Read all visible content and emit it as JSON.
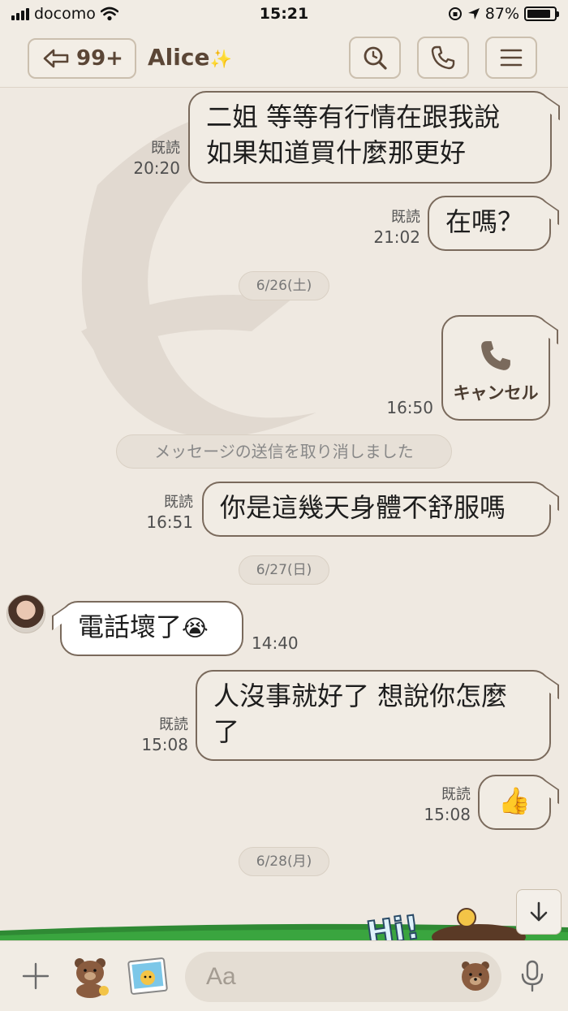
{
  "status_bar": {
    "carrier": "docomo",
    "time": "15:21",
    "battery_text": "87%",
    "battery_level": 0.87
  },
  "header": {
    "unread_count": "99+",
    "contact_name": "Alice",
    "contact_emoji": "✨",
    "icons": [
      "back-arrow-icon",
      "search-icon",
      "phone-icon",
      "menu-icon"
    ]
  },
  "messages": {
    "m1": {
      "line1": "二姐 等等有行情在跟我說",
      "line2": "如果知道買什麼那更好",
      "read": "既読",
      "time": "20:20"
    },
    "m2": {
      "text": "在嗎？",
      "read": "既読",
      "time": "21:02"
    },
    "date1": "6/26(土)",
    "m3": {
      "label": "キャンセル",
      "time": "16:50"
    },
    "system": "メッセージの送信を取り消しました",
    "m4": {
      "text": "你是這幾天身體不舒服嗎",
      "read": "既読",
      "time": "16:51"
    },
    "date2": "6/27(日)",
    "m5": {
      "text": "電話壞了",
      "emoji": "😭",
      "time": "14:40"
    },
    "m6": {
      "line1": "人沒事就好了 想說你怎麼",
      "line2": "了",
      "read": "既読",
      "time": "15:08"
    },
    "m7": {
      "emoji": "👍",
      "read": "既読",
      "time": "15:08"
    },
    "date3": "6/28(月)"
  },
  "banner_text": "Hi!",
  "input": {
    "placeholder": "Aa"
  },
  "colors": {
    "background": "#efe9e1",
    "bubble_border": "#7a6a5c",
    "accent": "#5b4636"
  }
}
